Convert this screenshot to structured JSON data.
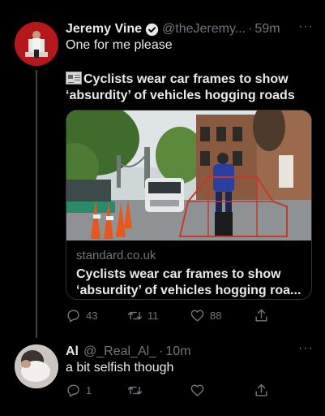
{
  "tweet1": {
    "name": "Jeremy Vine",
    "handle": "@theJeremy...",
    "separator": "·",
    "time": "59m",
    "more": "···",
    "text": "One for me please",
    "headline": "Cyclists wear car frames to show ‘absurdity’ of vehicles hogging roads",
    "card": {
      "domain": "standard.co.uk",
      "title": "Cyclists wear car frames to show ‘absurdity’ of vehicles hogging roa..."
    },
    "replies": "43",
    "retweets": "11",
    "likes": "88"
  },
  "tweet2": {
    "name": "Al",
    "handle": "@_Real_Al_",
    "separator": "·",
    "time": "10m",
    "more": "···",
    "text": "a bit selfish though",
    "replies": "1",
    "retweets": "",
    "likes": ""
  },
  "icons": {
    "reply": "reply-icon",
    "retweet": "retweet-icon",
    "like": "heart-icon",
    "share": "share-icon",
    "verified": "verified-badge-icon",
    "news": "newspaper-emoji-icon"
  },
  "colors": {
    "background": "#000000",
    "text": "#e7e9ea",
    "muted": "#71767b",
    "border": "#2f3336",
    "verified": "#1d9bf0"
  }
}
